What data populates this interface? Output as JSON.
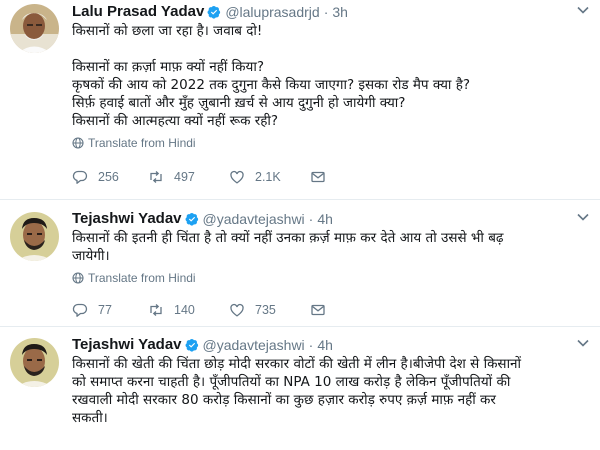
{
  "tweets": [
    {
      "author": "Lalu Prasad Yadav",
      "handle": "@laluprasadrjd",
      "separator": "·",
      "time": "3h",
      "lines": [
        "किसानों को छला जा रहा है। जवाब दो!",
        "",
        "किसानों का क़र्ज़ा माफ़ क्यों नहीं किया?",
        "कृषकों की आय को 2022 तक दुगुना कैसे किया जाएगा? इसका रोड मैप क्या है?",
        "सिर्फ़ हवाई बातों और मुँह ज़ुबानी ख़र्च से आय दुगुनी हो जायेगी क्या?",
        "किसानों की आत्महत्या क्यों नहीं रूक रही?"
      ],
      "translate": "Translate from Hindi",
      "replies": "256",
      "retweets": "497",
      "likes": "2.1K"
    },
    {
      "author": "Tejashwi Yadav",
      "handle": "@yadavtejashwi",
      "separator": "·",
      "time": "4h",
      "lines": [
        "किसानों की इतनी ही चिंता है तो क्यों नहीं उनका क़र्ज़ माफ़ कर देते आय तो उससे भी बढ़",
        "जायेगी।"
      ],
      "translate": "Translate from Hindi",
      "replies": "77",
      "retweets": "140",
      "likes": "735"
    },
    {
      "author": "Tejashwi Yadav",
      "handle": "@yadavtejashwi",
      "separator": "·",
      "time": "4h",
      "lines": [
        "किसानों की खेती की चिंता छोड़ मोदी सरकार वोटों की खेती में लीन है।बीजेपी देश से किसानों",
        "को समाप्त करना चाहती है। पूँजीपतियों का NPA 10 लाख करोड़ है लेकिन पूँजीपतियों की",
        "रखवाली मोदी सरकार 80 करोड़ किसानों का कुछ हज़ार करोड़ रुपए क़र्ज़ माफ़ नहीं कर",
        "सकती।"
      ]
    }
  ],
  "icons": {
    "verified": "verified-badge-icon",
    "caret": "chevron-down-icon",
    "globe": "globe-icon",
    "reply": "reply-icon",
    "retweet": "retweet-icon",
    "like": "heart-icon",
    "dm": "envelope-icon"
  },
  "colors": {
    "verified": "#1da1f2",
    "text": "#14171a",
    "secondary": "#657786",
    "divider": "#e6ecf0"
  }
}
